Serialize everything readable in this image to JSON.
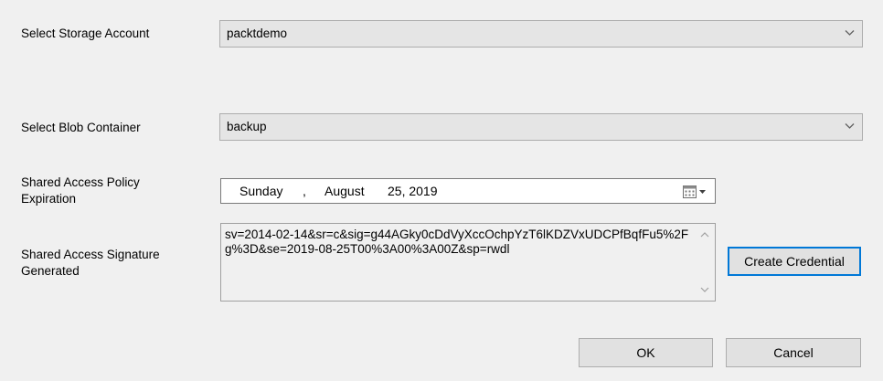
{
  "storage_account": {
    "label": "Select Storage Account",
    "selected": "packtdemo",
    "icon": "chevron-down-icon"
  },
  "blob_container": {
    "label": "Select Blob Container",
    "selected": "backup",
    "icon": "chevron-down-icon"
  },
  "policy_expiration": {
    "label_line1": "Shared Access Policy",
    "label_line2": "Expiration",
    "weekday": "Sunday",
    "separator": ",",
    "month": "August",
    "day_year": "25, 2019",
    "icon": "calendar-dropdown-icon"
  },
  "sas_generated": {
    "label_line1": "Shared Access Signature",
    "label_line2": "Generated",
    "value": "sv=2014-02-14&sr=c&sig=g44AGky0cDdVyXccOchpYzT6lKDZVxUDCPfBqfFu5%2Fg%3D&se=2019-08-25T00%3A00%3A00Z&sp=rwdl"
  },
  "buttons": {
    "create_credential": "Create Credential",
    "ok": "OK",
    "cancel": "Cancel"
  },
  "colors": {
    "background": "#f0f0f0",
    "control": "#e5e5e5",
    "focus_border": "#0078d7"
  }
}
